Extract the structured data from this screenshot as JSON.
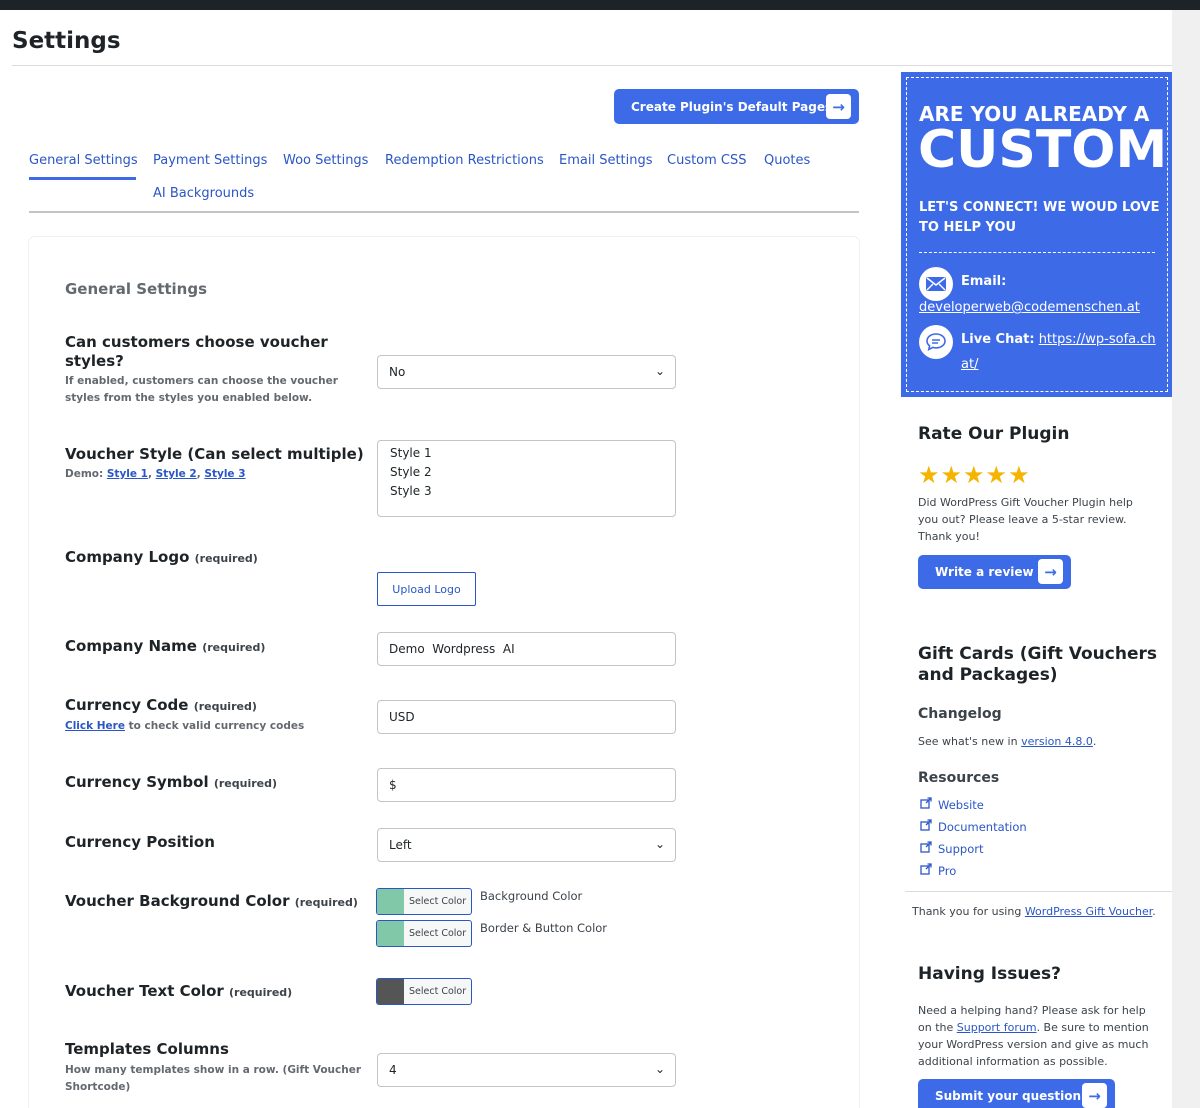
{
  "page": {
    "title": "Settings"
  },
  "cta": {
    "label": "Create Plugin's Default Pages"
  },
  "tabs": [
    {
      "label": "General Settings"
    },
    {
      "label": "Payment Settings"
    },
    {
      "label": "Woo Settings"
    },
    {
      "label": "Redemption Restrictions"
    },
    {
      "label": "Email Settings"
    },
    {
      "label": "Custom CSS"
    },
    {
      "label": "Quotes"
    },
    {
      "label": "AI Backgrounds"
    }
  ],
  "general": {
    "section_title": "General Settings",
    "voucher_styles_choice": {
      "label_line1": "Can customers choose voucher",
      "label_line2": "styles?",
      "desc_line1": "If enabled, customers can choose the voucher",
      "desc_line2": "styles from the styles you enabled below.",
      "value": "No"
    },
    "voucher_style": {
      "label": "Voucher Style (Can select multiple)",
      "demo_prefix": "Demo:",
      "demo_links": [
        "Style 1",
        "Style 2",
        "Style 3"
      ],
      "options": [
        "Style 1",
        "Style 2",
        "Style 3"
      ]
    },
    "company_logo": {
      "label": "Company Logo",
      "req": "(required)",
      "button": "Upload Logo"
    },
    "company_name": {
      "label": "Company Name",
      "req": "(required)",
      "value": "Demo  Wordpress  AI"
    },
    "currency_code": {
      "label": "Currency Code",
      "req": "(required)",
      "link": "Click Here",
      "desc": "to check valid currency codes",
      "value": "USD"
    },
    "currency_symbol": {
      "label": "Currency Symbol",
      "req": "(required)",
      "value": "$"
    },
    "currency_position": {
      "label": "Currency Position",
      "value": "Left"
    },
    "voucher_bg_color": {
      "label": "Voucher Background Color",
      "req": "(required)",
      "button": "Select Color",
      "bg_label": "Background Color",
      "border_label": "Border & Button Color",
      "bg_color": "#81c8a8",
      "border_color": "#81c8a8"
    },
    "voucher_text_color": {
      "label": "Voucher Text Color",
      "req": "(required)",
      "button": "Select Color",
      "color": "#555555"
    },
    "templates_columns": {
      "label": "Templates Columns",
      "desc_line1": "How many templates show in a row. (Gift Voucher",
      "desc_line2": "Shortcode)",
      "value": "4"
    }
  },
  "promo": {
    "small_head": "ARE YOU ALREADY A",
    "big_head": "CUSTOMER",
    "tagline": "LET'S CONNECT! WE WOUD LOVE TO HELP YOU",
    "email_label": "Email:",
    "email": "developerweb@codemenschen.at",
    "chat_label": "Live Chat:",
    "chat_link": "https://wp-sofa.chat/"
  },
  "rate": {
    "title": "Rate Our Plugin",
    "stars": "★★★★★",
    "rating": 5,
    "text": "Did WordPress Gift Voucher Plugin help you out? Please leave a 5-star review. Thank you!",
    "button": "Write a review"
  },
  "info": {
    "title": "Gift Cards (Gift Vouchers and Packages)",
    "changelog_title": "Changelog",
    "changelog_prefix": "See what's new in",
    "changelog_link": "version 4.8.0",
    "changelog_suffix": ".",
    "resources_title": "Resources",
    "resources": [
      "Website",
      "Documentation",
      "Support",
      "Pro"
    ],
    "thanks_prefix": "Thank you for using",
    "thanks_link": "WordPress Gift Voucher",
    "thanks_suffix": "."
  },
  "issues": {
    "title": "Having Issues?",
    "text_a": "Need a helping hand? Please ask for help on the",
    "forum_link": "Support forum",
    "text_b": ". Be sure to mention your WordPress version and give as much additional information as possible.",
    "button": "Submit your question"
  }
}
